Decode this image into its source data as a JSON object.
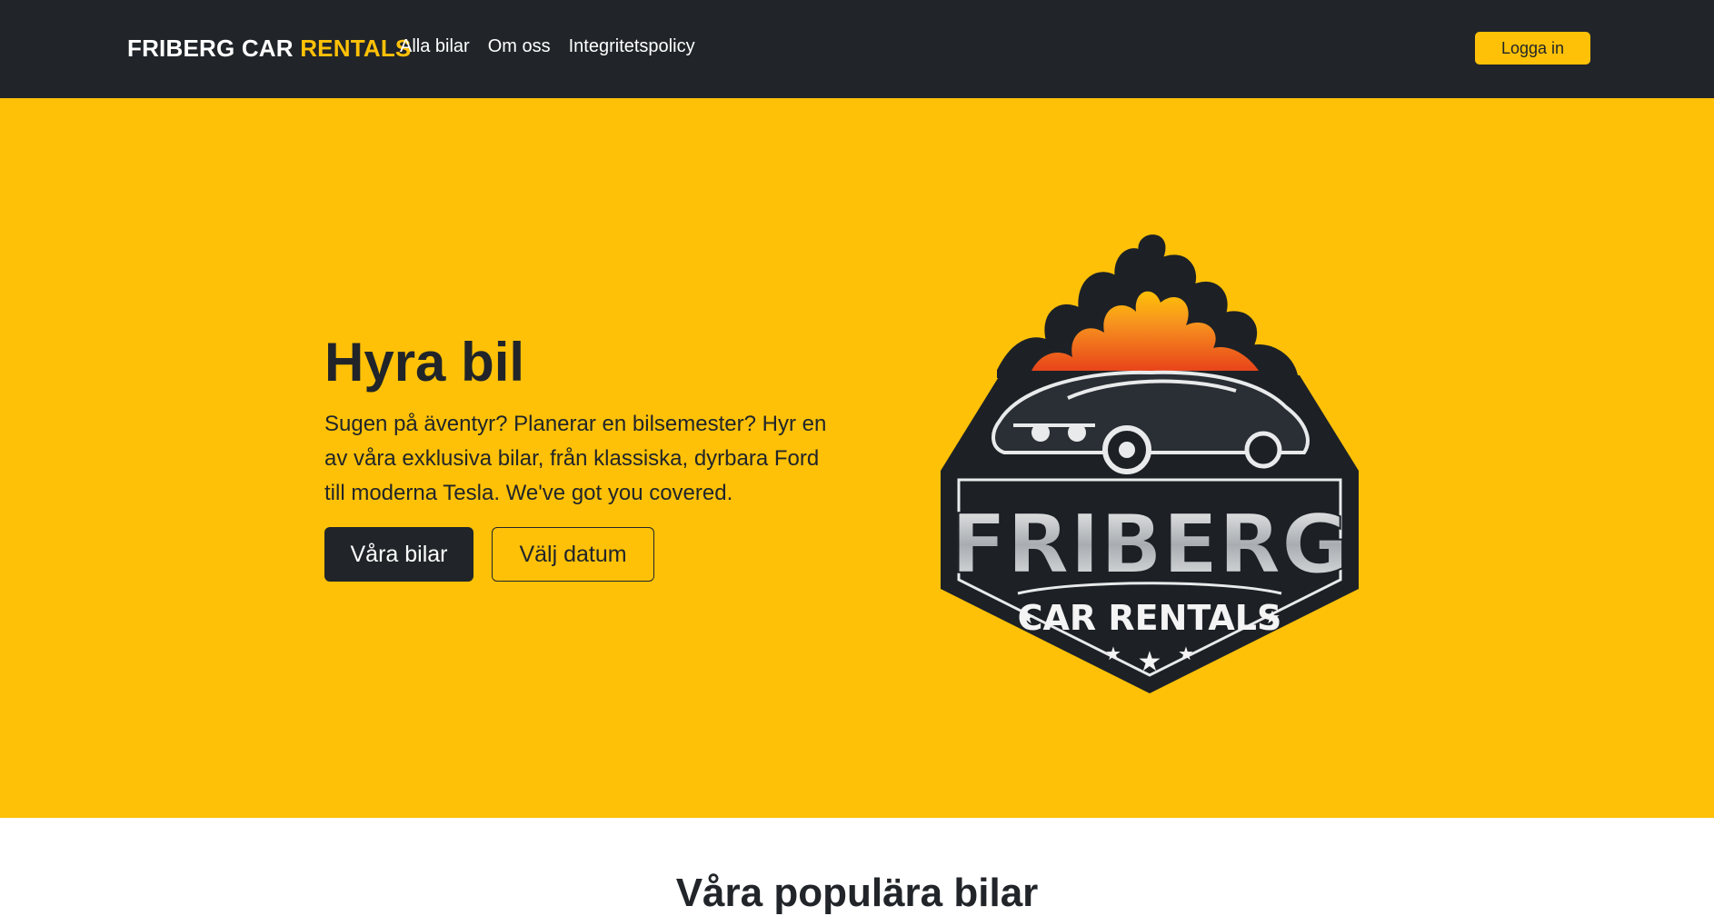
{
  "navbar": {
    "brand_main": "FRIBERG CAR",
    "brand_accent": "RENTALS",
    "links": [
      "Alla bilar",
      "Om oss",
      "Integritetspolicy"
    ],
    "login_label": "Logga in"
  },
  "hero": {
    "title": "Hyra bil",
    "text": "Sugen på äventyr? Planerar en bilsemester? Hyr en av våra exklusiva bilar, från klassiska, dyrbara Ford till moderna Tesla. We've got you covered.",
    "primary_button": "Våra bilar",
    "secondary_button": "Välj datum",
    "logo": {
      "word_1": "FRIBERG",
      "word_2": "CAR RENTALS"
    }
  },
  "next_section": {
    "title": "Våra populära bilar"
  },
  "colors": {
    "accent": "#ffc107",
    "dark": "#212529",
    "flame": "#f26a1b"
  }
}
